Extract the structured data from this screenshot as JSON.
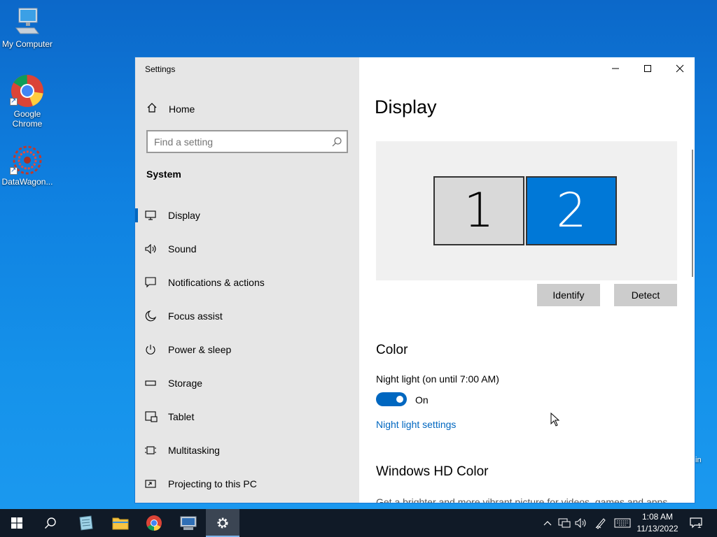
{
  "desktop": {
    "icons": [
      {
        "label": "My Computer"
      },
      {
        "label": "Google Chrome"
      },
      {
        "label": "DataWagon..."
      }
    ],
    "partial_text": "in"
  },
  "window": {
    "title": "Settings",
    "buttons": {
      "minimize": "minimize-icon",
      "maximize": "maximize-icon",
      "close": "close-icon"
    }
  },
  "sidebar": {
    "home_label": "Home",
    "search_placeholder": "Find a setting",
    "section_title": "System",
    "items": [
      {
        "label": "Display",
        "icon": "monitor-icon",
        "active": true
      },
      {
        "label": "Sound",
        "icon": "speaker-icon"
      },
      {
        "label": "Notifications & actions",
        "icon": "notification-icon"
      },
      {
        "label": "Focus assist",
        "icon": "moon-icon"
      },
      {
        "label": "Power & sleep",
        "icon": "power-icon"
      },
      {
        "label": "Storage",
        "icon": "storage-icon"
      },
      {
        "label": "Tablet",
        "icon": "tablet-icon"
      },
      {
        "label": "Multitasking",
        "icon": "multitasking-icon"
      },
      {
        "label": "Projecting to this PC",
        "icon": "projecting-icon"
      }
    ]
  },
  "main": {
    "title": "Display",
    "monitors": [
      "1",
      "2"
    ],
    "identify_label": "Identify",
    "detect_label": "Detect",
    "color_title": "Color",
    "night_light_label": "Night light (on until 7:00 AM)",
    "night_light_state": "On",
    "night_light_link": "Night light settings",
    "hd_color_title": "Windows HD Color",
    "hd_color_desc": "Get a brighter and more vibrant picture for videos, games and apps"
  },
  "taskbar": {
    "time": "1:08 AM",
    "date": "11/13/2022",
    "notification_count": "1"
  },
  "colors": {
    "accent": "#0067c0",
    "monitor_selected": "#0078d7",
    "sidebar_bg": "#e6e6e6",
    "taskbar_bg": "#101a27"
  }
}
